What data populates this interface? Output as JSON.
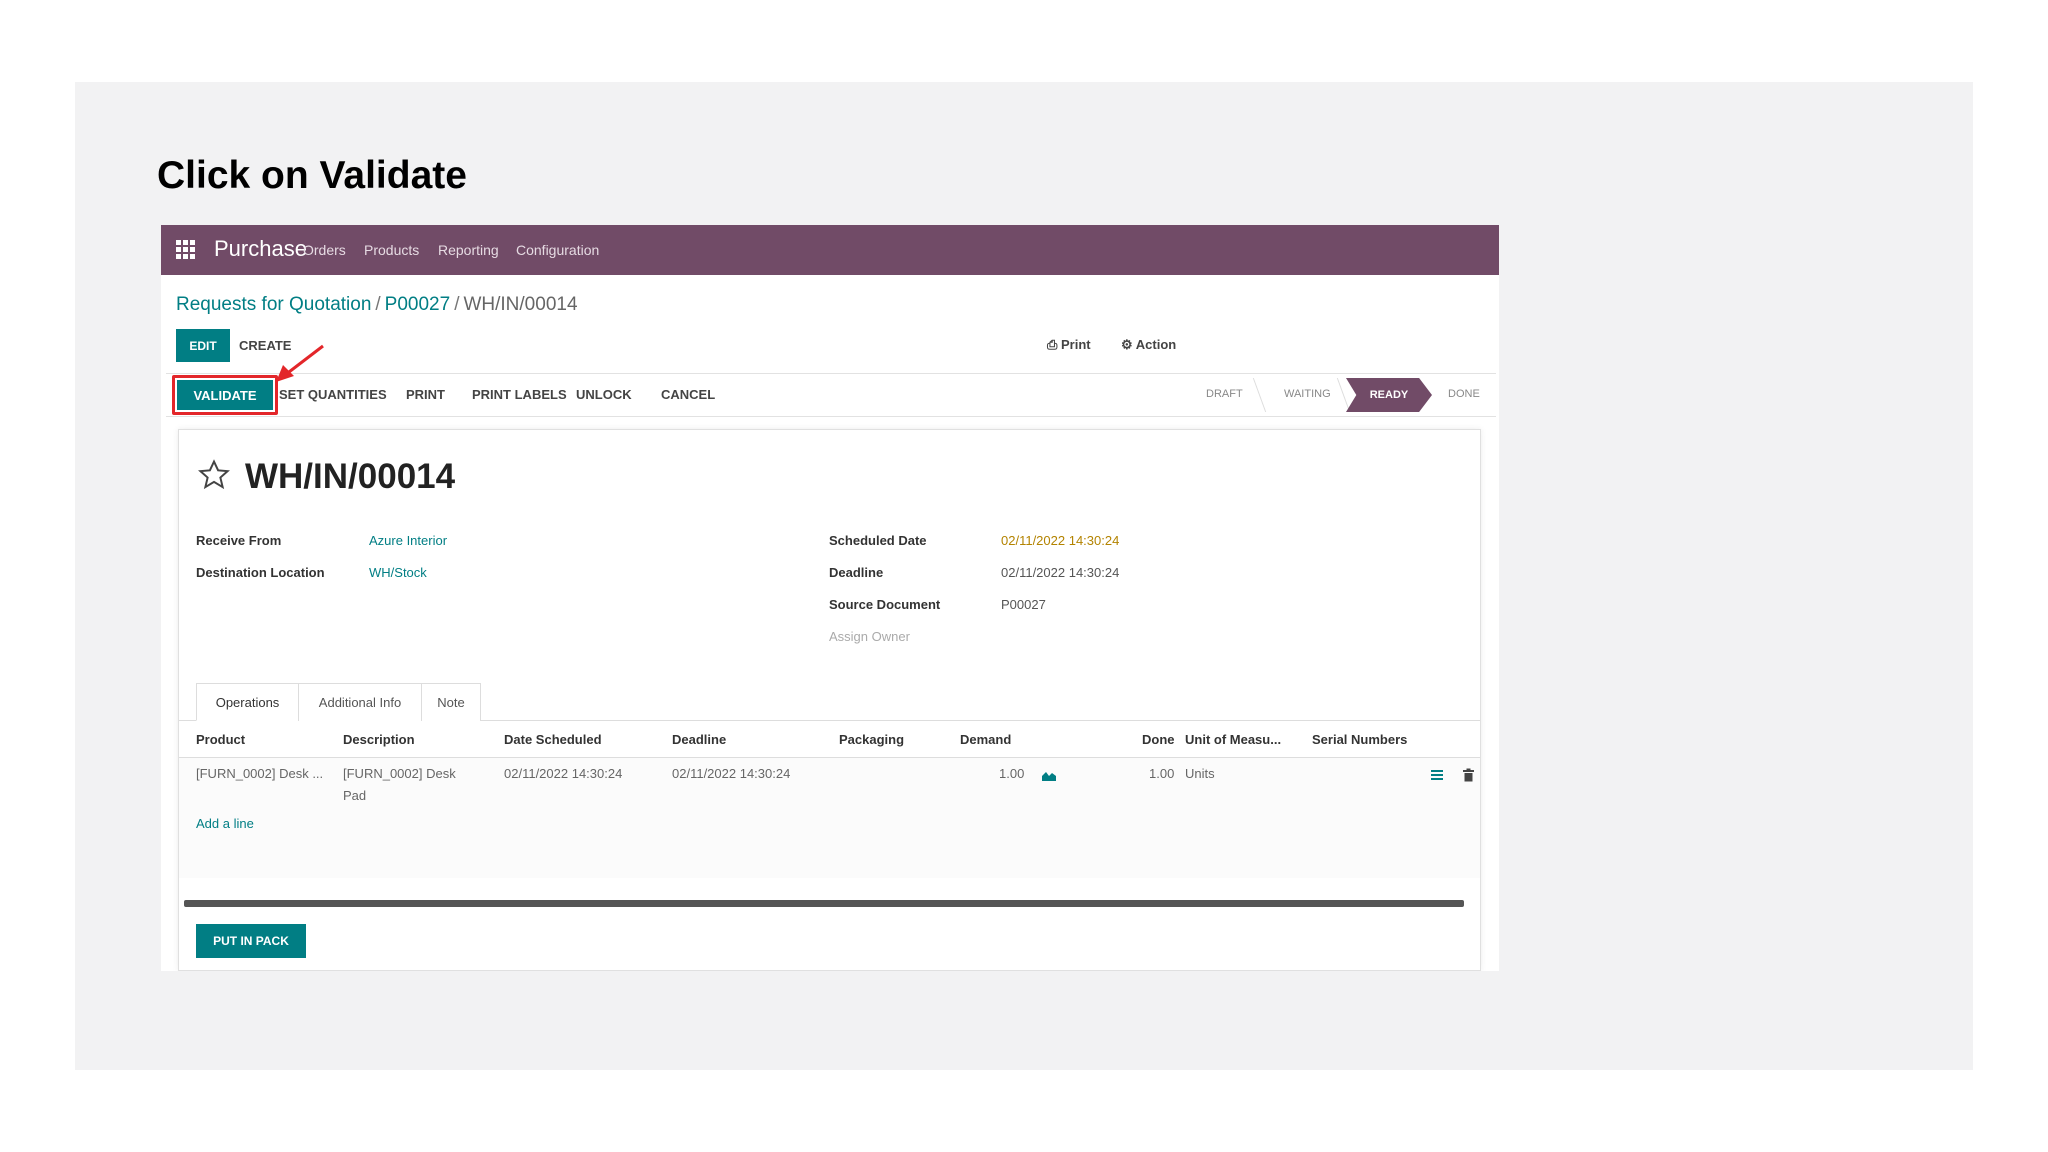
{
  "instruction": "Click on Validate",
  "navbar": {
    "app_name": "Purchase",
    "menu": [
      "Orders",
      "Products",
      "Reporting",
      "Configuration"
    ]
  },
  "breadcrumb": {
    "items": [
      "Requests for Quotation",
      "P00027"
    ],
    "current": "WH/IN/00014"
  },
  "controls": {
    "edit": "EDIT",
    "create": "CREATE",
    "print": "⎙ Print",
    "action": "⚙ Action"
  },
  "statusbar": {
    "buttons": [
      "VALIDATE",
      "SET QUANTITIES",
      "PRINT",
      "PRINT LABELS",
      "UNLOCK",
      "CANCEL"
    ],
    "stages": [
      "DRAFT",
      "WAITING",
      "READY",
      "DONE"
    ],
    "active_stage": "READY"
  },
  "record": {
    "title": "WH/IN/00014",
    "receive_from_label": "Receive From",
    "receive_from": "Azure Interior",
    "destination_label": "Destination Location",
    "destination": "WH/Stock",
    "scheduled_label": "Scheduled Date",
    "scheduled": "02/11/2022 14:30:24",
    "deadline_label": "Deadline",
    "deadline": "02/11/2022 14:30:24",
    "source_label": "Source Document",
    "source": "P00027",
    "assign_owner": "Assign Owner"
  },
  "tabs": [
    "Operations",
    "Additional Info",
    "Note"
  ],
  "table": {
    "headers": [
      "Product",
      "Description",
      "Date Scheduled",
      "Deadline",
      "Packaging",
      "Demand",
      "Done",
      "Unit of Measu...",
      "Serial Numbers"
    ],
    "row": {
      "product": "[FURN_0002] Desk ...",
      "description_1": "[FURN_0002] Desk",
      "description_2": "Pad",
      "date_scheduled": "02/11/2022 14:30:24",
      "deadline": "02/11/2022 14:30:24",
      "demand": "1.00",
      "done": "1.00",
      "uom": "Units"
    },
    "add_line": "Add a line"
  },
  "put_in_pack": "PUT IN PACK",
  "colors": {
    "brand": "#714b67",
    "primary": "#017e84",
    "highlight": "#e3262a"
  }
}
